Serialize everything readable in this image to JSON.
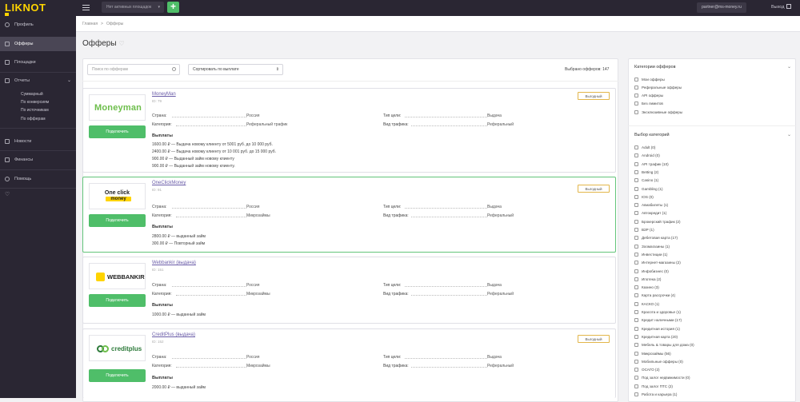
{
  "topbar": {
    "logo": "LIKNOT",
    "platform_select": "Нет активных площадок",
    "add_label": "+",
    "email": "partner@ms-money.ru",
    "logout": "Выход"
  },
  "sidebar": {
    "items": [
      {
        "label": "Профиль",
        "icon": "user-icon"
      },
      {
        "label": "Офферы",
        "icon": "offers-icon"
      },
      {
        "label": "Площадки",
        "icon": "platforms-icon"
      },
      {
        "label": "Отчеты",
        "icon": "chart-icon"
      },
      {
        "label": "Новости",
        "icon": "news-icon"
      },
      {
        "label": "Финансы",
        "icon": "finance-icon"
      },
      {
        "label": "Помощь",
        "icon": "help-icon"
      }
    ],
    "reports_sub": [
      "Суммарный",
      "По конверсиям",
      "По источникам",
      "По офферам"
    ]
  },
  "breadcrumb": {
    "home": "Главная",
    "sep": ">",
    "current": "Офферы"
  },
  "page_title": "Офферы",
  "filters": {
    "search_placeholder": "Поиск по офферам",
    "sort_label": "Сортировать по выплате",
    "selected_count": "Выбрано офферов: 147"
  },
  "offer_labels": {
    "country": "Страна:",
    "category": "Категория:",
    "target_type": "Тип цели:",
    "traffic_type": "Вид трафика:",
    "payouts": "Выплаты",
    "connect": "Подключить"
  },
  "offers": [
    {
      "name": "MoneyMan",
      "id": "ID: 79",
      "badge": "Выгодный",
      "logo_text": "Moneyman",
      "country": "Россия",
      "category": "Реферальный трафик",
      "target_type": "Выдача",
      "traffic_type": "Реферальный",
      "payouts": [
        "1600.00 ₽ — Выдача новому клиенту от 5001 руб. до 10 000 руб.",
        "2400.00 ₽ — Выдача новому клиенту от 10 001 руб. до 15 000 руб.",
        "900.00 ₽ — Выданный займ новому клиенту",
        "900.00 ₽ — Выданный займ новому клиенту."
      ]
    },
    {
      "name": "OneClickMoney",
      "id": "ID: 91",
      "badge": "Выгодный",
      "logo_text_top": "One click",
      "logo_text_bottom": "money",
      "country": "Россия",
      "category": "Микрозаймы",
      "target_type": "Выдача",
      "traffic_type": "Реферальный",
      "payouts": [
        "2800.00 ₽ — выданный займ",
        "300.00 ₽ — Повторный займ"
      ]
    },
    {
      "name": "Webbankir (выдача)",
      "id": "ID: 151",
      "badge": "",
      "logo_text": "WEBBANKIR",
      "country": "Россия",
      "category": "Микрозаймы",
      "target_type": "Выдача",
      "traffic_type": "Реферальный",
      "payouts": [
        "1000.00 ₽ — выданный займ"
      ]
    },
    {
      "name": "CreditPlus (выдача)",
      "id": "ID: 152",
      "badge": "Выгодный",
      "logo_text": "creditplus",
      "country": "Россия",
      "category": "Микрозаймы",
      "target_type": "Выдача",
      "traffic_type": "Реферальный",
      "payouts": [
        "2000.00 ₽ — выданный займ"
      ]
    }
  ],
  "right_panel": {
    "offer_categories_title": "Категории офферов",
    "offer_categories": [
      "Мои офферы",
      "Реферальные офферы",
      "API офферы",
      "Без лимитов",
      "Эксклюзивные офферы"
    ],
    "category_select_title": "Выбор категорий",
    "categories": [
      "Adult (0)",
      "Android (0)",
      "API трафик (10)",
      "Betting (2)",
      "Casino (1)",
      "Gambling (1)",
      "IOS (0)",
      "Авиабилеты (1)",
      "Автокредит (1)",
      "Брокерский трафик (2)",
      "ВЗР (1)",
      "Дебетовая карта (17)",
      "Зоомагазины (1)",
      "Инвестиции (1)",
      "Интернет-магазины (2)",
      "Инфобизнес (0)",
      "Ипотека (2)",
      "Казино (3)",
      "Карта рассрочки (4)",
      "КАСКО (1)",
      "Красота и здоровье (1)",
      "Кредит наличными (17)",
      "Кредитная история (1)",
      "Кредитная карта (20)",
      "Мебель & товары для дома (0)",
      "Микрозаймы (56)",
      "Мобильные офферы (0)",
      "ОСАГО (2)",
      "Под залог недвижимости (0)",
      "Под залог ПТС (2)",
      "Работа и карьера (1)"
    ]
  },
  "colors": {
    "sidebar_bg": "#2a2633",
    "accent_green": "#4fbe69",
    "logo_yellow": "#ffd400",
    "link_purple": "#6a5ca8",
    "badge_border": "#e2b64a",
    "highlight_border": "#63c47a"
  }
}
